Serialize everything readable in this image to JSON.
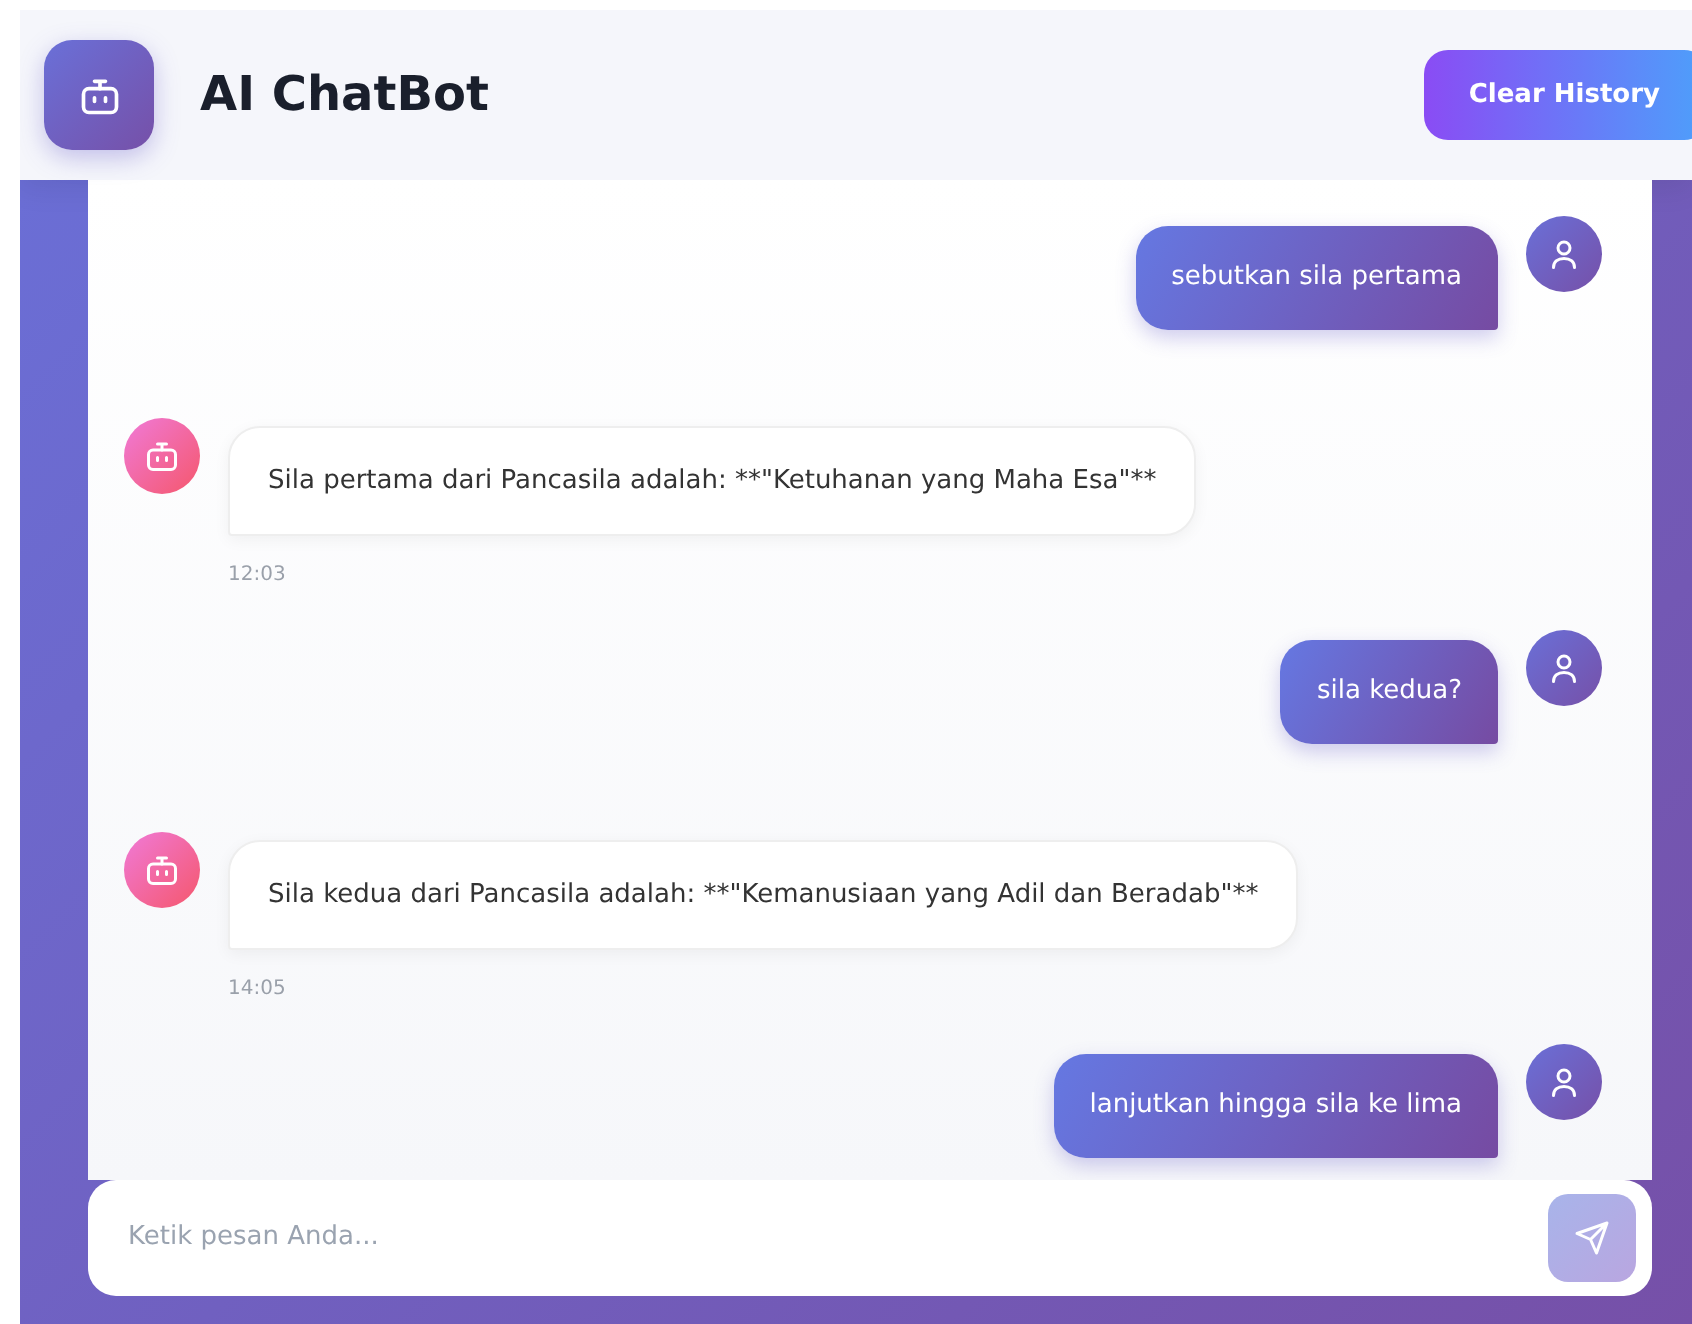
{
  "header": {
    "title": "AI ChatBot",
    "clear_button": "Clear History"
  },
  "messages": [
    {
      "kind": "user",
      "text": "sebutkan sila pertama"
    },
    {
      "kind": "bot",
      "text": "Sila pertama dari Pancasila adalah: **\"Ketuhanan yang Maha Esa\"**",
      "time": "12:03"
    },
    {
      "kind": "user",
      "text": "sila kedua?"
    },
    {
      "kind": "bot",
      "text": "Sila kedua dari Pancasila adalah: **\"Kemanusiaan yang Adil dan Beradab\"**",
      "time": "14:05"
    },
    {
      "kind": "user",
      "text": "lanjutkan hingga sila ke lima"
    }
  ],
  "composer": {
    "placeholder": "Ketik pesan Anda...",
    "send_disabled": true
  }
}
